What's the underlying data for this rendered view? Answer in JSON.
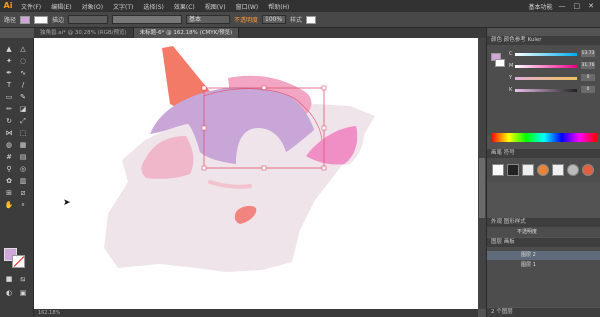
{
  "app": {
    "logo": "Ai",
    "workspace": "基本功能"
  },
  "menu": [
    "文件(F)",
    "编辑(E)",
    "对象(O)",
    "文字(T)",
    "选择(S)",
    "效果(C)",
    "视图(V)",
    "窗口(W)",
    "帮助(H)"
  ],
  "window_controls": [
    "—",
    "□",
    "✕"
  ],
  "control_bar": {
    "selection_label": "路径",
    "stroke_label": "描边",
    "stroke_style": "基本",
    "opacity_label": "不透明度",
    "opacity_value": "100%",
    "style_label": "样式"
  },
  "tabs": [
    {
      "label": "独角兽.ai* @ 30.28% (RGB/预览)",
      "active": false
    },
    {
      "label": "未标题-6* @ 162.18% (CMYK/预览)",
      "active": true
    }
  ],
  "status": {
    "zoom": "162.18%"
  },
  "colors": {
    "fill": "#cfa7d8",
    "accent_orange": "#ff9a3a",
    "ui_dark": "#323232"
  },
  "panels": {
    "color": {
      "tabs": "颜色  颜色参考  Kuler",
      "channels": [
        {
          "label": "C",
          "value": "13.73"
        },
        {
          "label": "M",
          "value": "31.76"
        },
        {
          "label": "Y",
          "value": "0"
        },
        {
          "label": "K",
          "value": "0"
        }
      ]
    },
    "brushes": {
      "tabs": "画笔  符号"
    },
    "appearance": {
      "tabs": "外观  图形样式",
      "option": "不透明度"
    },
    "layers": {
      "tabs": "图层  画板",
      "rows": [
        {
          "label": "图层 2"
        },
        {
          "label": "图层 1"
        }
      ],
      "footer": "2 个图层"
    }
  }
}
